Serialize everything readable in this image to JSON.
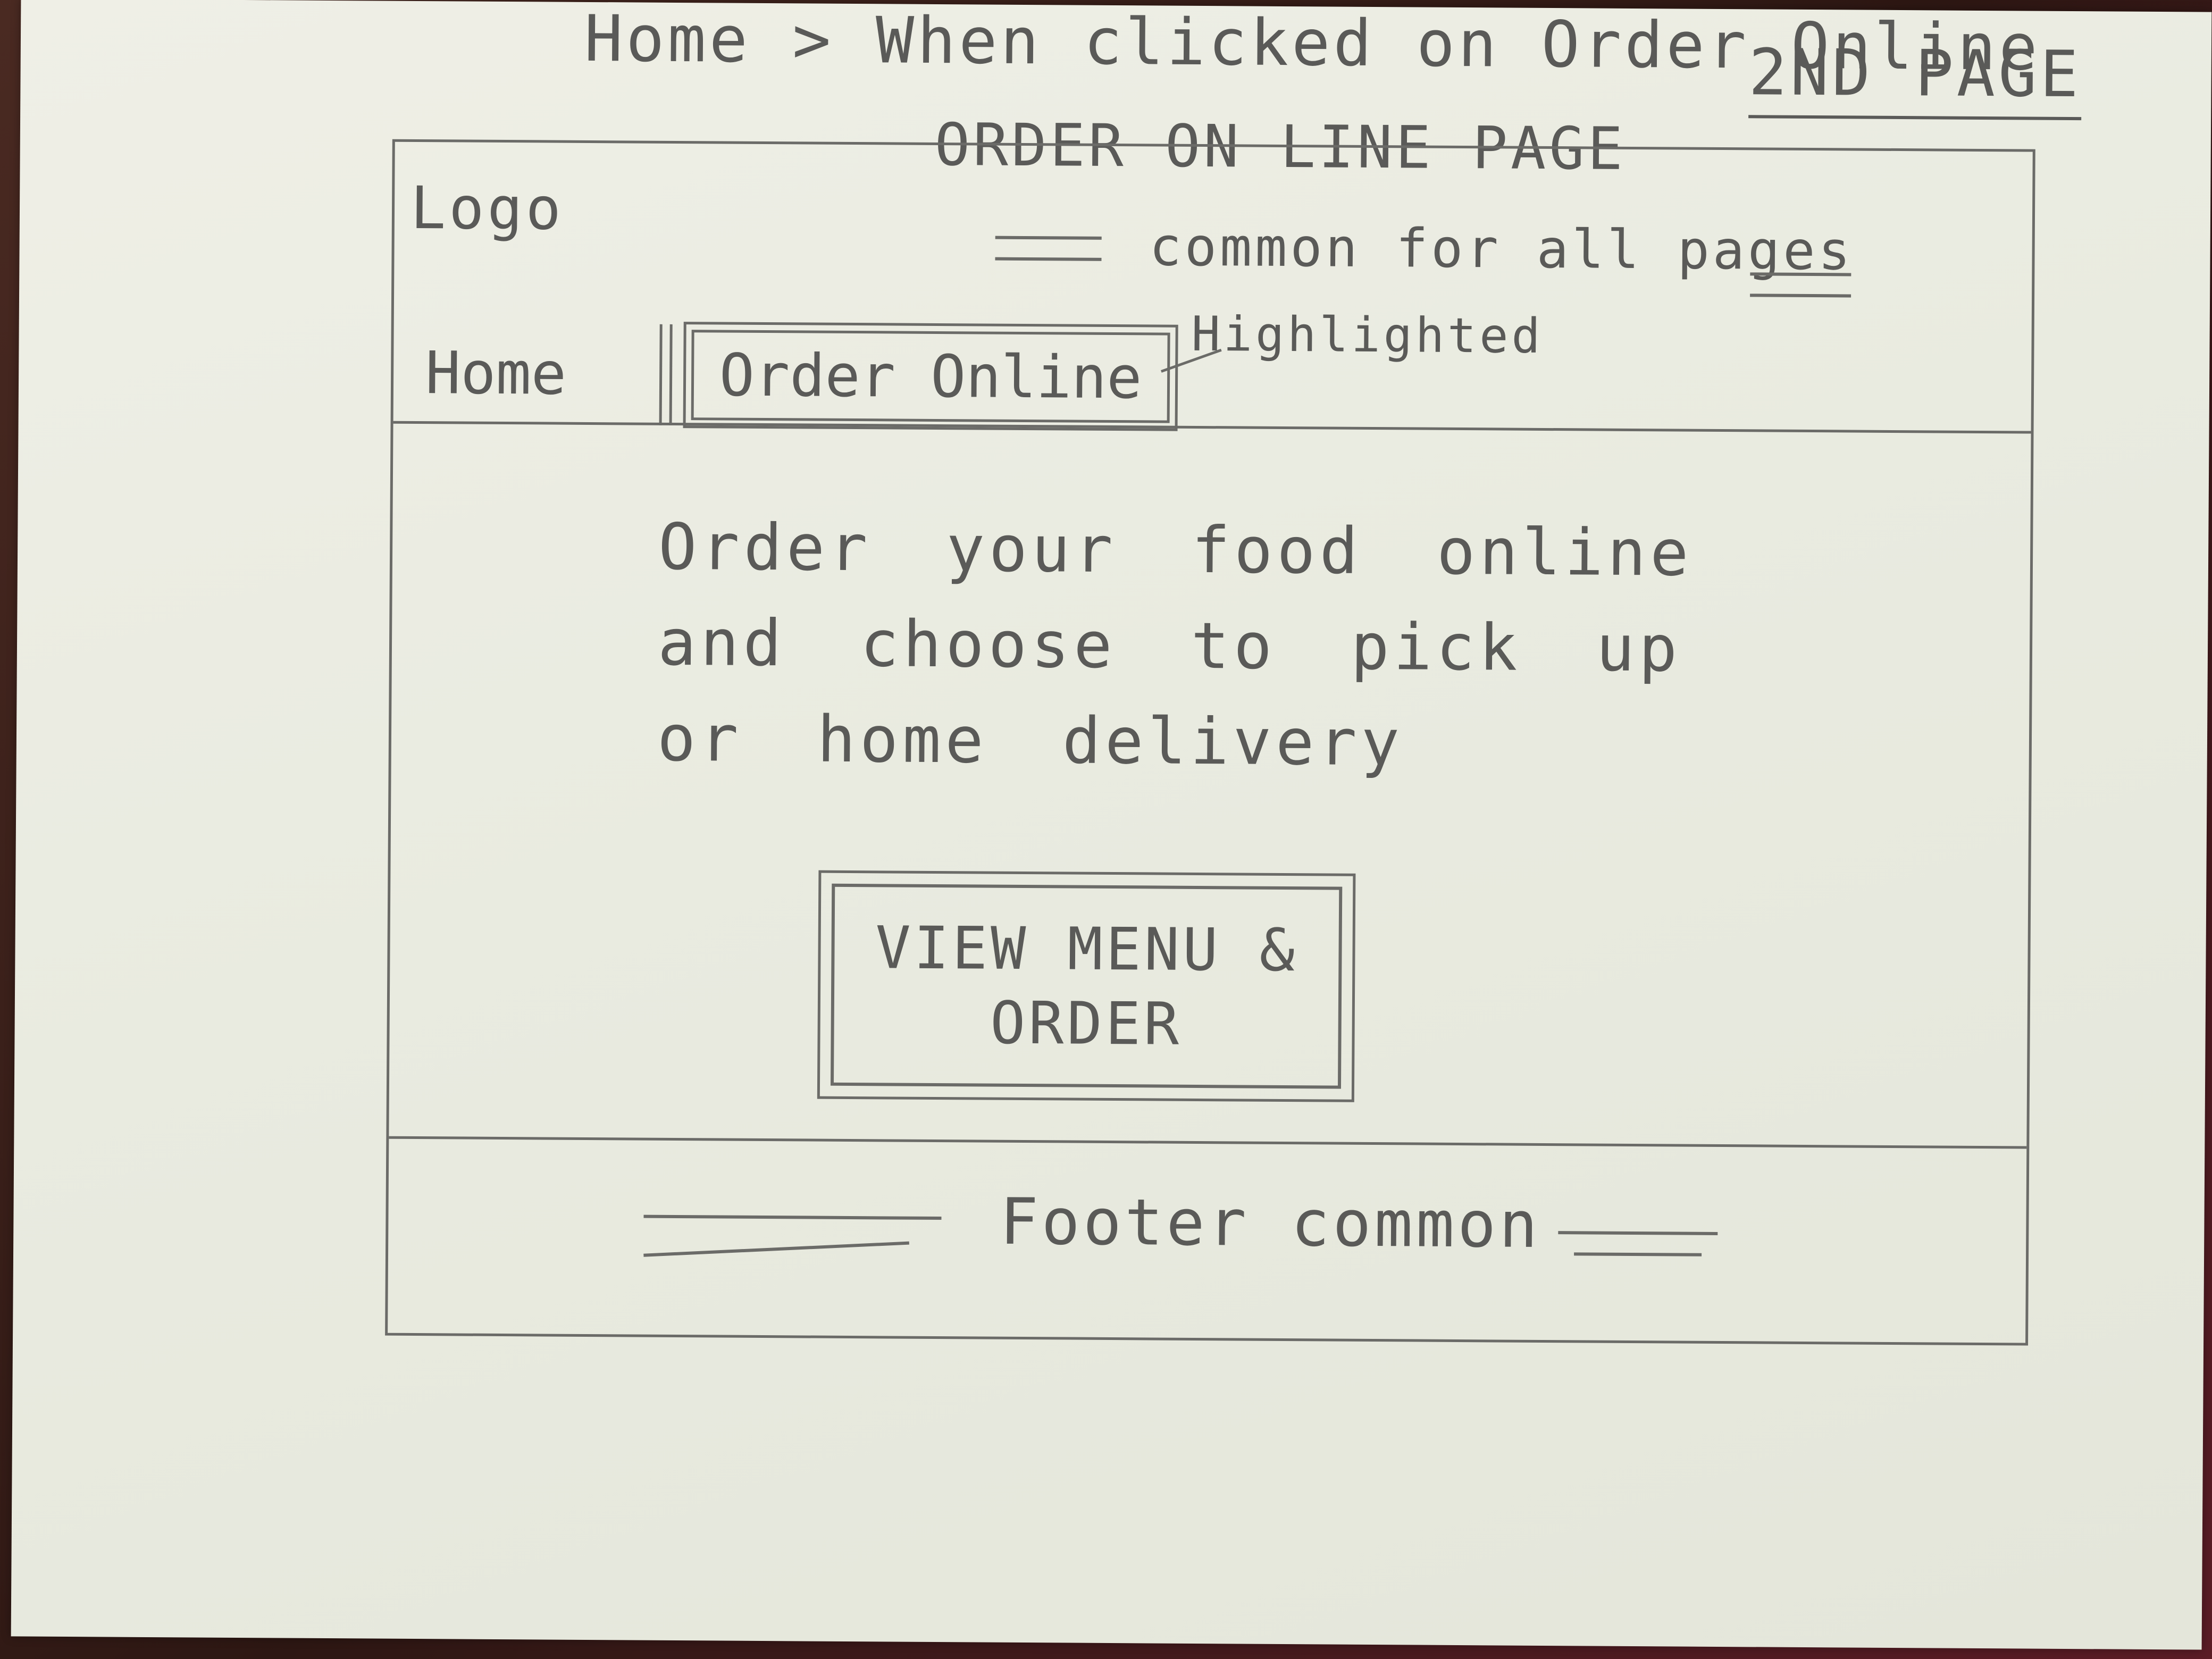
{
  "annotations": {
    "flow_note": "Home > When clicked on Order Online",
    "page_label": "2ND PAGE",
    "page_title": "ORDER ON LINE PAGE",
    "header_note": "common for all pages",
    "highlight_note": "Highlighted"
  },
  "header": {
    "logo_label": "Logo"
  },
  "nav": {
    "home_label": "Home",
    "order_online_label": "Order Online"
  },
  "content": {
    "intro_text": "Order your food online and choose to pick up or home delivery",
    "cta_label": "VIEW MENU &\nORDER"
  },
  "footer": {
    "label": "Footer common"
  }
}
